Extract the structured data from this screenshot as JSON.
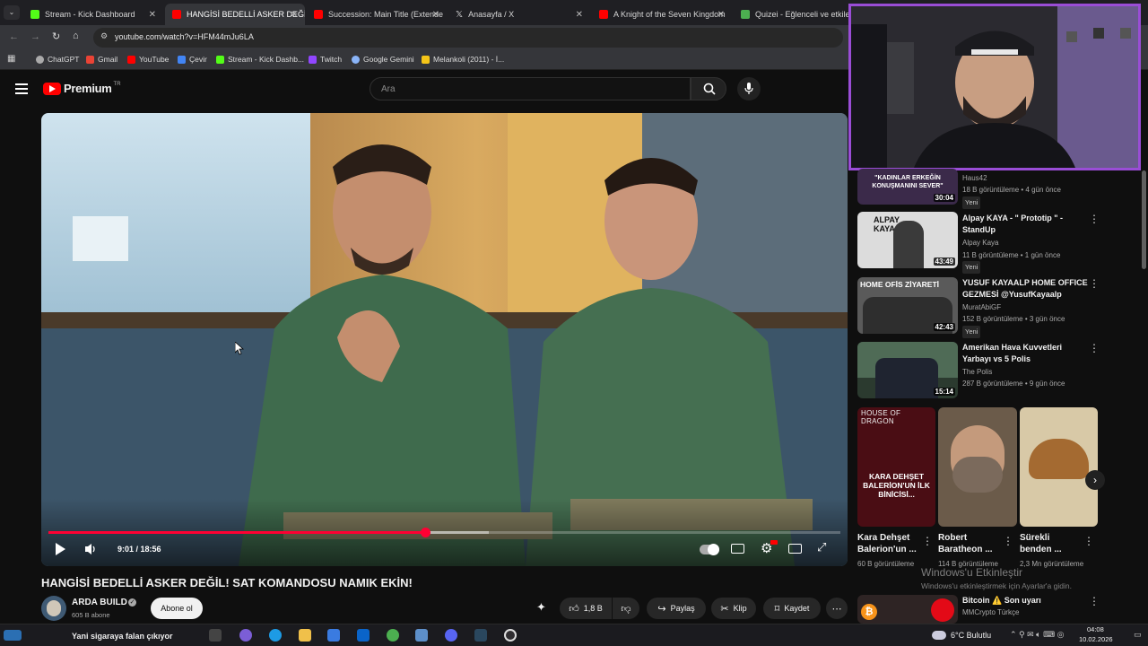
{
  "browser": {
    "tabs": [
      {
        "title": "Stream - Kick Dashboard",
        "color": "#53fc18"
      },
      {
        "title": "HANGİSİ BEDELLİ ASKER DEĞİL",
        "color": "#ff0000"
      },
      {
        "title": "Succession: Main Title (Extende",
        "color": "#ff0000"
      },
      {
        "title": "Anasayfa / X",
        "color": "#ffffff"
      },
      {
        "title": "A Knight of the Seven Kingdom",
        "color": "#ff0000"
      },
      {
        "title": "Quizei - Eğlenceli ve etkileşi",
        "color": "#4caf50"
      }
    ],
    "url": "youtube.com/watch?v=HFM44mJu6LA",
    "bookmarks": [
      "ChatGPT",
      "Gmail",
      "YouTube",
      "Çevir",
      "Stream - Kick Dashb...",
      "Twitch",
      "Google Gemini",
      "Melankoli (2011) - İ..."
    ]
  },
  "youtube": {
    "logo_text": "Premium",
    "logo_sup": "TR",
    "search_placeholder": "Ara"
  },
  "player": {
    "time": "9:01 / 18:56",
    "progress": 0.476,
    "buffered": 0.556
  },
  "video": {
    "title": "HANGİSİ BEDELLİ ASKER DEĞİL! SAT KOMANDOSU NAMIK EKİN!",
    "channel": "ARDA BUILD",
    "subscribers": "605 B abone",
    "subscribe_label": "Abone ol",
    "likes": "1,8 B",
    "share_label": "Paylaş",
    "clip_label": "Klip",
    "save_label": "Kaydet"
  },
  "sidebar": {
    "items": [
      {
        "thumb_text": "\"KADINLAR ERKEĞİN KONUŞMANINI SEVER\"",
        "duration": "30:04",
        "title": "",
        "channel": "Haus42",
        "meta": "18 B görüntüleme • 4 gün önce",
        "badge": "Yeni"
      },
      {
        "thumb_text": "ALPAY KAYA",
        "duration": "43:49",
        "title": "Alpay KAYA - \" Prototip \" - StandUp",
        "channel": "Alpay Kaya",
        "meta": "11 B görüntüleme • 1 gün önce",
        "badge": "Yeni"
      },
      {
        "thumb_text": "HOME OFİS ZİYARETİ",
        "duration": "42:43",
        "title": "YUSUF KAYAALP HOME OFFICE GEZMESİ @YusufKayaalp",
        "channel": "MuratAbiGF",
        "meta": "152 B görüntüleme • 3 gün önce",
        "badge": "Yeni"
      },
      {
        "thumb_text": "",
        "duration": "15:14",
        "title": "Amerikan Hava Kuvvetleri Yarbayı vs 5 Polis",
        "channel": "The Polis",
        "meta": "287 B görüntüleme • 9 gün önce",
        "badge": ""
      }
    ],
    "shorts": [
      {
        "thumb_top": "HOUSE OF DRAGON",
        "thumb_text": "KARA DEHŞET BALERİON'UN İLK BİNİCİSİ...",
        "title": "Kara Dehşet Balerion'un ...",
        "views": "60 B görüntüleme"
      },
      {
        "thumb_top": "",
        "thumb_text": "",
        "title": "Robert Baratheon ...",
        "views": "114 B görüntüleme"
      },
      {
        "thumb_top": "",
        "thumb_text": "",
        "title": "Sürekli benden ...",
        "views": "2,3 Mn görüntüleme"
      }
    ],
    "last": {
      "title": "Bitcoin ⚠️ Son uyarı",
      "channel": "MMCrypto Türkçe"
    }
  },
  "windows_watermark": {
    "line1": "Windows'u Etkinleştir",
    "line2": "Windows'u etkinleştirmek için Ayarlar'a gidin."
  },
  "taskbar": {
    "stream_text": "Yani sigaraya falan çıkıyor",
    "weather": "6°C  Bulutlu",
    "time": "04:08",
    "date": "10.02.2026"
  }
}
